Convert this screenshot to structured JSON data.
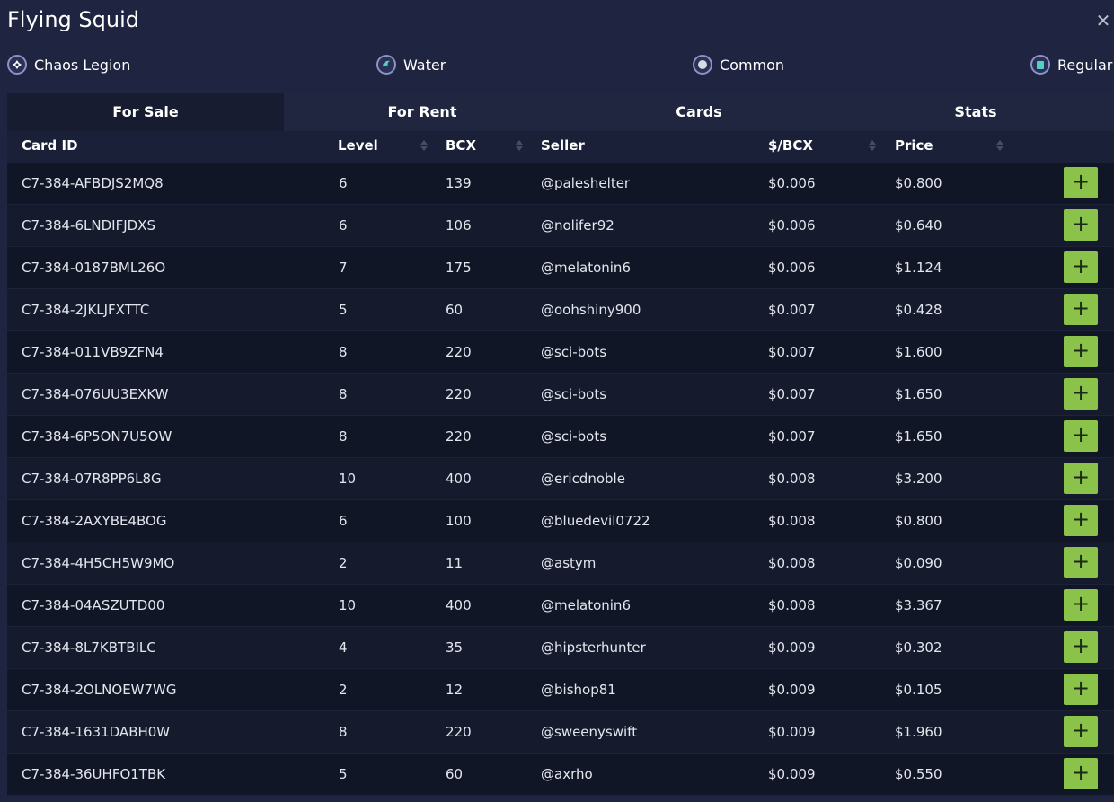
{
  "title": "Flying Squid",
  "attributes": [
    {
      "label": "Chaos Legion",
      "icon": "chaos-legion-icon"
    },
    {
      "label": "Water",
      "icon": "water-icon"
    },
    {
      "label": "Common",
      "icon": "common-rarity-icon"
    },
    {
      "label": "Regular",
      "icon": "regular-edition-icon"
    }
  ],
  "tabs": [
    {
      "label": "For Sale",
      "active": true
    },
    {
      "label": "For Rent",
      "active": false
    },
    {
      "label": "Cards",
      "active": false
    },
    {
      "label": "Stats",
      "active": false
    }
  ],
  "columns": {
    "card_id": "Card ID",
    "level": "Level",
    "bcx": "BCX",
    "seller": "Seller",
    "price_per_bcx": "$/BCX",
    "price": "Price"
  },
  "rows": [
    {
      "card_id": "C7-384-AFBDJS2MQ8",
      "level": "6",
      "bcx": "139",
      "seller": "@paleshelter",
      "price_per_bcx": "$0.006",
      "price": "$0.800"
    },
    {
      "card_id": "C7-384-6LNDIFJDXS",
      "level": "6",
      "bcx": "106",
      "seller": "@nolifer92",
      "price_per_bcx": "$0.006",
      "price": "$0.640"
    },
    {
      "card_id": "C7-384-0187BML26O",
      "level": "7",
      "bcx": "175",
      "seller": "@melatonin6",
      "price_per_bcx": "$0.006",
      "price": "$1.124"
    },
    {
      "card_id": "C7-384-2JKLJFXTTC",
      "level": "5",
      "bcx": "60",
      "seller": "@oohshiny900",
      "price_per_bcx": "$0.007",
      "price": "$0.428"
    },
    {
      "card_id": "C7-384-011VB9ZFN4",
      "level": "8",
      "bcx": "220",
      "seller": "@sci-bots",
      "price_per_bcx": "$0.007",
      "price": "$1.600"
    },
    {
      "card_id": "C7-384-076UU3EXKW",
      "level": "8",
      "bcx": "220",
      "seller": "@sci-bots",
      "price_per_bcx": "$0.007",
      "price": "$1.650"
    },
    {
      "card_id": "C7-384-6P5ON7U5OW",
      "level": "8",
      "bcx": "220",
      "seller": "@sci-bots",
      "price_per_bcx": "$0.007",
      "price": "$1.650"
    },
    {
      "card_id": "C7-384-07R8PP6L8G",
      "level": "10",
      "bcx": "400",
      "seller": "@ericdnoble",
      "price_per_bcx": "$0.008",
      "price": "$3.200"
    },
    {
      "card_id": "C7-384-2AXYBE4BOG",
      "level": "6",
      "bcx": "100",
      "seller": "@bluedevil0722",
      "price_per_bcx": "$0.008",
      "price": "$0.800"
    },
    {
      "card_id": "C7-384-4H5CH5W9MO",
      "level": "2",
      "bcx": "11",
      "seller": "@astym",
      "price_per_bcx": "$0.008",
      "price": "$0.090"
    },
    {
      "card_id": "C7-384-04ASZUTD00",
      "level": "10",
      "bcx": "400",
      "seller": "@melatonin6",
      "price_per_bcx": "$0.008",
      "price": "$3.367"
    },
    {
      "card_id": "C7-384-8L7KBTBILC",
      "level": "4",
      "bcx": "35",
      "seller": "@hipsterhunter",
      "price_per_bcx": "$0.009",
      "price": "$0.302"
    },
    {
      "card_id": "C7-384-2OLNOEW7WG",
      "level": "2",
      "bcx": "12",
      "seller": "@bishop81",
      "price_per_bcx": "$0.009",
      "price": "$0.105"
    },
    {
      "card_id": "C7-384-1631DABH0W",
      "level": "8",
      "bcx": "220",
      "seller": "@sweenyswift",
      "price_per_bcx": "$0.009",
      "price": "$1.960"
    },
    {
      "card_id": "C7-384-36UHFO1TBK",
      "level": "5",
      "bcx": "60",
      "seller": "@axrho",
      "price_per_bcx": "$0.009",
      "price": "$0.550"
    }
  ],
  "colors": {
    "background": "#1f2440",
    "accent_green": "#8bc34a"
  }
}
